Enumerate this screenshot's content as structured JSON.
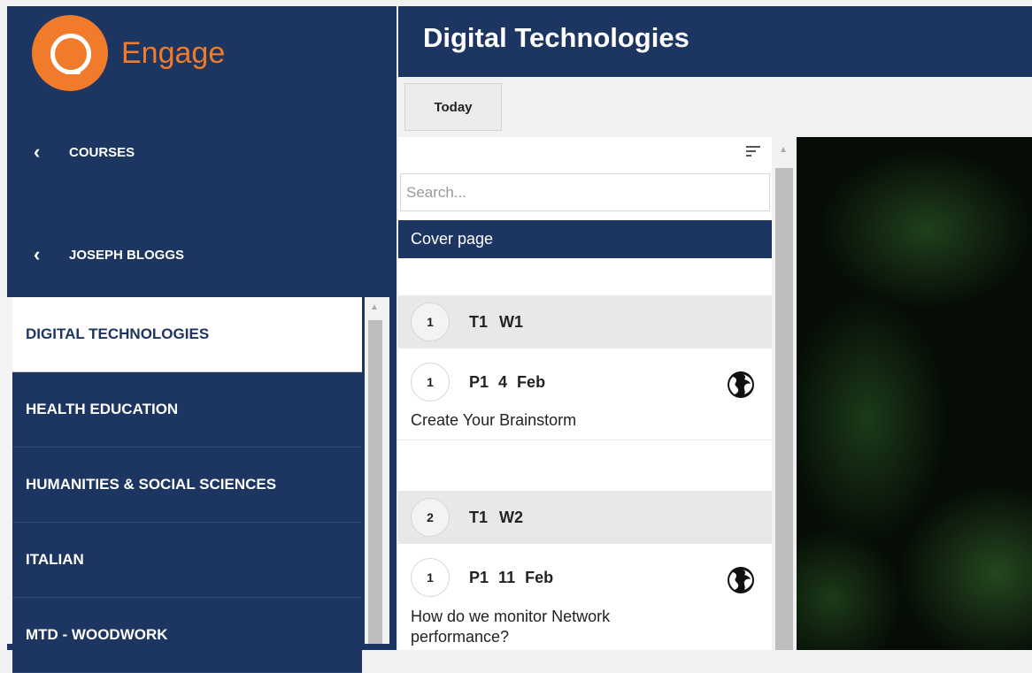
{
  "app": {
    "name": "Engage"
  },
  "sidebar": {
    "back_links": [
      {
        "label": "COURSES"
      },
      {
        "label": "JOSEPH BLOGGS"
      }
    ],
    "courses": [
      {
        "label": "DIGITAL TECHNOLOGIES",
        "active": true
      },
      {
        "label": "HEALTH EDUCATION",
        "active": false
      },
      {
        "label": "HUMANITIES & SOCIAL SCIENCES",
        "active": false
      },
      {
        "label": "ITALIAN",
        "active": false
      },
      {
        "label": "MTD - WOODWORK",
        "active": false
      }
    ]
  },
  "header": {
    "title": "Digital Technologies"
  },
  "toolbar": {
    "today_label": "Today"
  },
  "list": {
    "search_placeholder": "Search...",
    "cover_label": "Cover page",
    "weeks": [
      {
        "number": "1",
        "term": "T1",
        "week": "W1",
        "periods": [
          {
            "number": "1",
            "period": "P1",
            "date": "4 Feb",
            "title": "Create Your Brainstorm",
            "icon": "globe-icon"
          }
        ]
      },
      {
        "number": "2",
        "term": "T1",
        "week": "W2",
        "periods": [
          {
            "number": "1",
            "period": "P1",
            "date": "11 Feb",
            "title": "How do we monitor Network performance?",
            "icon": "globe-icon"
          }
        ]
      }
    ]
  },
  "colors": {
    "navy": "#1c3561",
    "orange": "#f07b2b",
    "white": "#ffffff"
  }
}
